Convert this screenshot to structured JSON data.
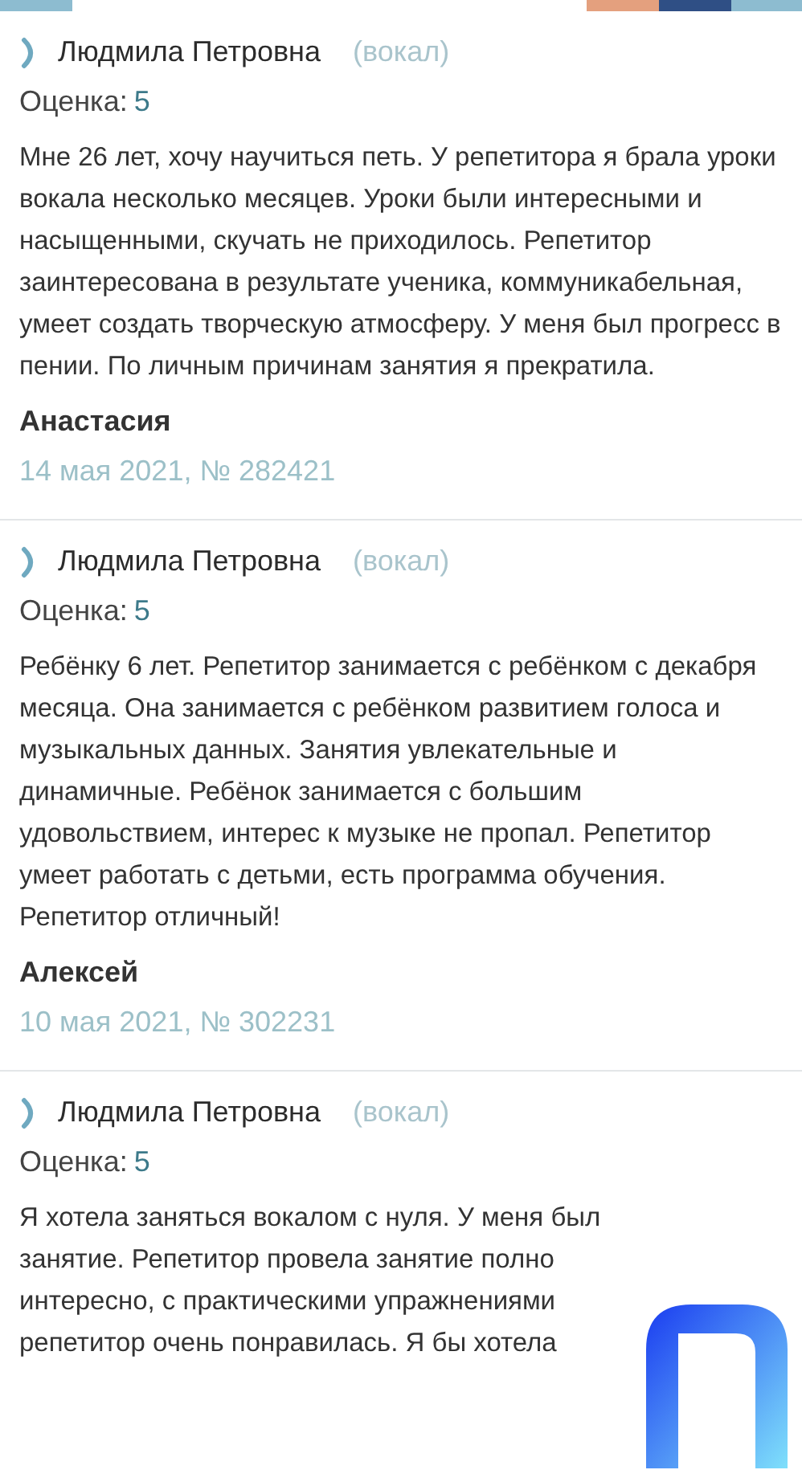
{
  "reviews": [
    {
      "tutor": "Людмила Петровна",
      "subject": "(вокал)",
      "rating_label": "Оценка:",
      "rating": "5",
      "text": "Мне 26 лет, хочу научиться петь. У репетитора я брала уроки вокала несколько месяцев. Уроки были интересными и насыщенными, скучать не приходилось. Репетитор заинтересована в результате ученика, коммуникабельная, умеет создать творческую атмосферу. У меня был прогресс в пении. По личным причинам занятия я прекратила.",
      "author": "Анастасия",
      "date": "14 мая 2021, № 282421"
    },
    {
      "tutor": "Людмила Петровна",
      "subject": "(вокал)",
      "rating_label": "Оценка:",
      "rating": "5",
      "text": "Ребёнку 6 лет. Репетитор занимается с ребёнком с декабря месяца. Она занимается с ребёнком развитием голоса и музыкальных данных. Занятия увлекательные и динамичные. Ребёнок занимается с большим удовольствием, интерес к музыке не пропал. Репетитор умеет работать с детьми, есть программа обучения. Репетитор отличный!",
      "author": "Алексей",
      "date": "10 мая 2021, № 302231"
    },
    {
      "tutor": "Людмила Петровна",
      "subject": "(вокал)",
      "rating_label": "Оценка:",
      "rating": "5",
      "text_lines": [
        "Я хотела заняться вокалом с нуля. У меня был",
        "занятие. Репетитор провела занятие полно",
        "интересно, с практическими упражнениями",
        "репетитор очень понравилась. Я бы хотела"
      ]
    }
  ]
}
